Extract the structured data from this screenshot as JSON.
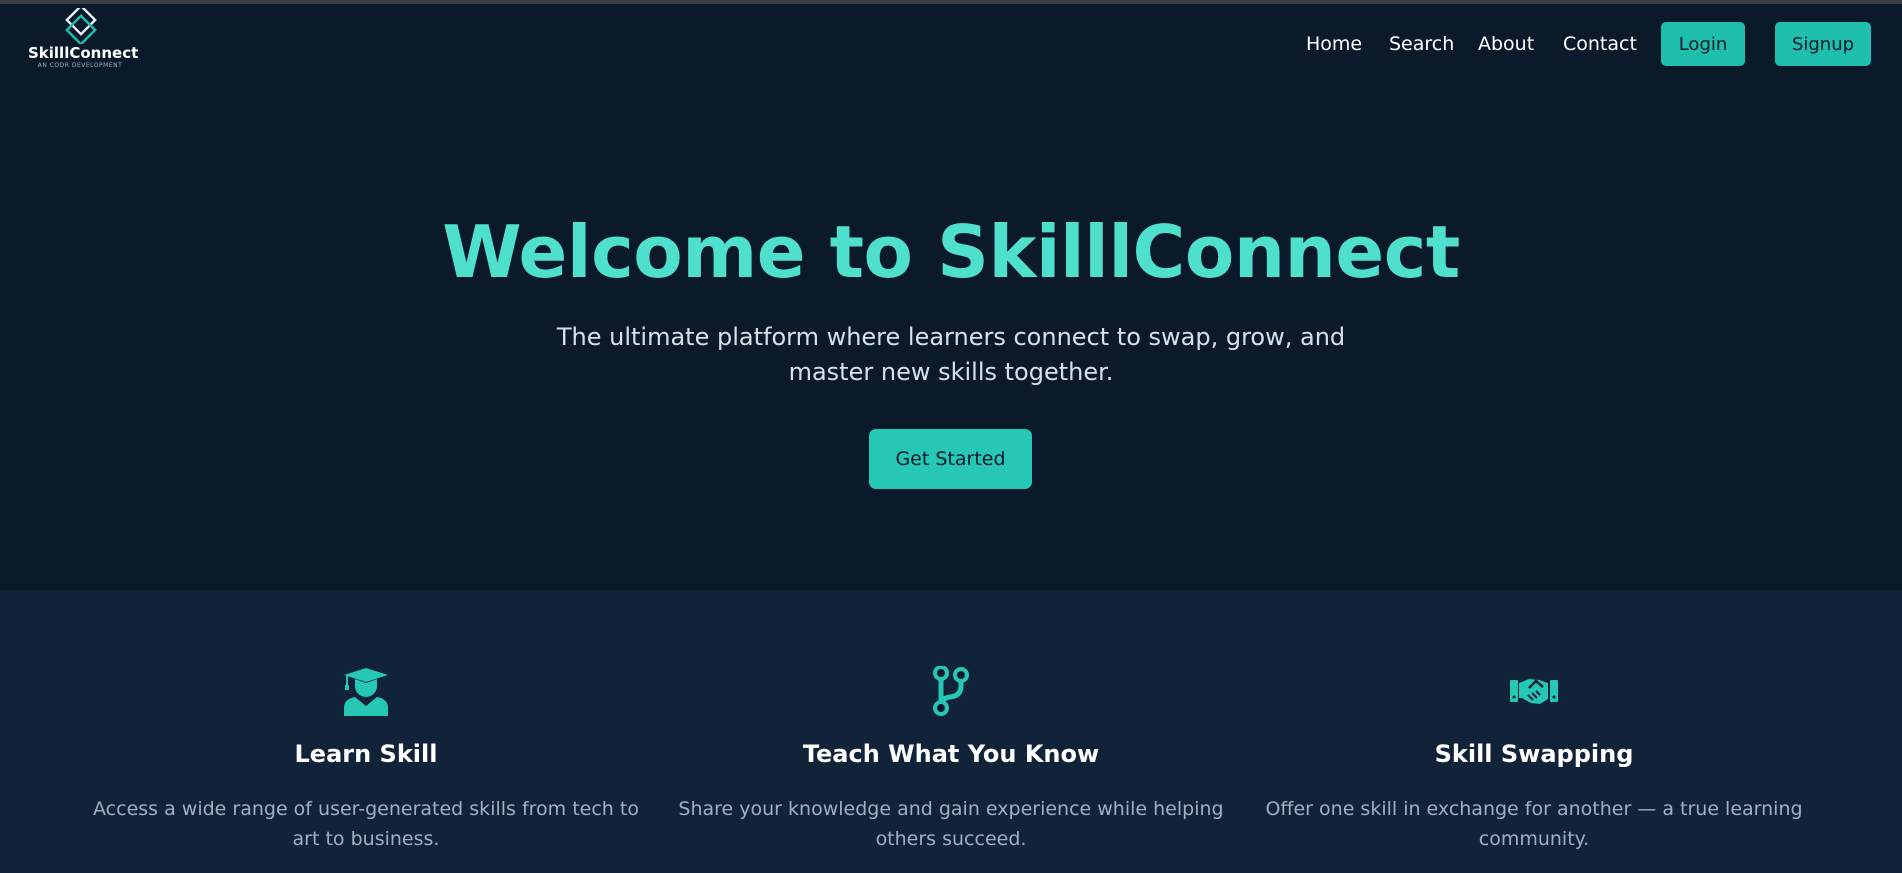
{
  "nav": {
    "logo_name": "SkilllConnect",
    "logo_tagline": "AN CODR DEVELOPMENT",
    "links": [
      "Home",
      "Search",
      "About",
      "Contact"
    ],
    "login_label": "Login",
    "signup_label": "Signup"
  },
  "hero": {
    "title": "Welcome to SkilllConnect",
    "subtitle": "The ultimate platform where learners connect to swap, grow, and master new skills together.",
    "cta_label": "Get Started"
  },
  "features": [
    {
      "icon": "graduate-icon",
      "title": "Learn Skill",
      "description": "Access a wide range of user-generated skills from tech to art to business."
    },
    {
      "icon": "code-branch-icon",
      "title": "Teach What You Know",
      "description": "Share your knowledge and gain experience while helping others succeed."
    },
    {
      "icon": "handshake-icon",
      "title": "Skill Swapping",
      "description": "Offer one skill in exchange for another — a true learning community."
    }
  ],
  "colors": {
    "background": "#0b1a2b",
    "features_background": "#112338",
    "accent": "#1fbfad",
    "heading": "#4fe0cd"
  }
}
